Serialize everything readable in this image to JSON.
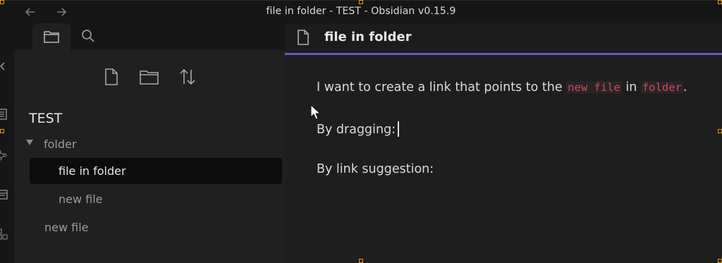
{
  "window": {
    "title": "file in folder - TEST - Obsidian v0.15.9",
    "back_icon": "arrow-left-icon",
    "forward_icon": "arrow-right-icon"
  },
  "sidebar": {
    "tabs": [
      {
        "name": "file-explorer",
        "icon": "folder-icon",
        "active": true
      },
      {
        "name": "search",
        "icon": "search-icon",
        "active": false
      }
    ],
    "toolbar": [
      {
        "name": "new-note",
        "icon": "new-file-icon"
      },
      {
        "name": "new-folder",
        "icon": "new-folder-icon"
      },
      {
        "name": "sort",
        "icon": "sort-icon"
      }
    ],
    "vault_name": "TEST",
    "tree": {
      "folder": {
        "label": "folder",
        "expanded": true
      },
      "children": [
        {
          "label": "file in folder",
          "active": true
        },
        {
          "label": "new file",
          "active": false
        }
      ],
      "root_files": [
        {
          "label": "new file"
        }
      ]
    }
  },
  "ribbon": {
    "icons": [
      "collapse-left-icon",
      "file-list-icon",
      "graph-icon",
      "template-icon",
      "canvas-icon"
    ]
  },
  "editor": {
    "title": "file in folder",
    "accent": "#6a55c4",
    "line1": {
      "prefix": "I want to create a link that points to the ",
      "code1": "new file",
      "middle": " in ",
      "code2": "folder",
      "suffix": "."
    },
    "line2": "By dragging:",
    "line3": "By link suggestion:"
  },
  "colors": {
    "code": "#e0405a",
    "selection_handles": "#e0a000"
  }
}
